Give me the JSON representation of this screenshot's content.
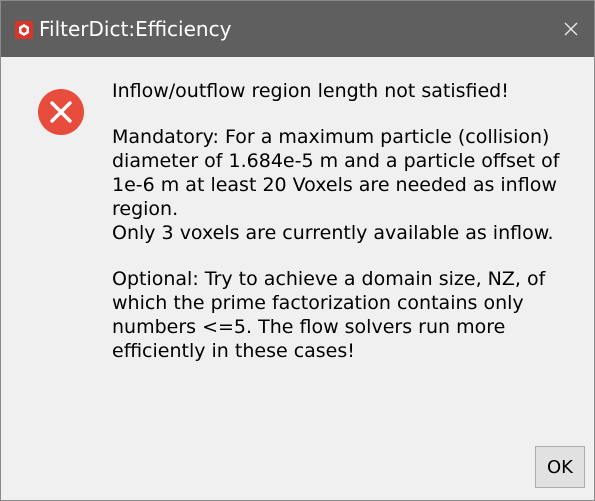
{
  "window": {
    "title": "FilterDict:Efficiency",
    "close_icon": "close-icon",
    "app_icon": "app-logo-icon"
  },
  "message": {
    "icon": "error-icon",
    "icon_color": "#e74c3c",
    "lines": [
      "Inflow/outflow region length not satisfied!",
      "",
      "Mandatory: For a maximum particle (collision)",
      "diameter of 1.684e-5 m and a particle offset of",
      "1e-6 m at least 20 Voxels are needed as inflow",
      "region.",
      "Only 3 voxels are currently available as inflow.",
      "",
      "Optional: Try to achieve a domain size, NZ, of",
      "which the prime factorization contains only",
      "numbers <=5. The flow solvers run more",
      "efficiently in these cases!"
    ]
  },
  "buttons": {
    "ok_label": "OK"
  }
}
